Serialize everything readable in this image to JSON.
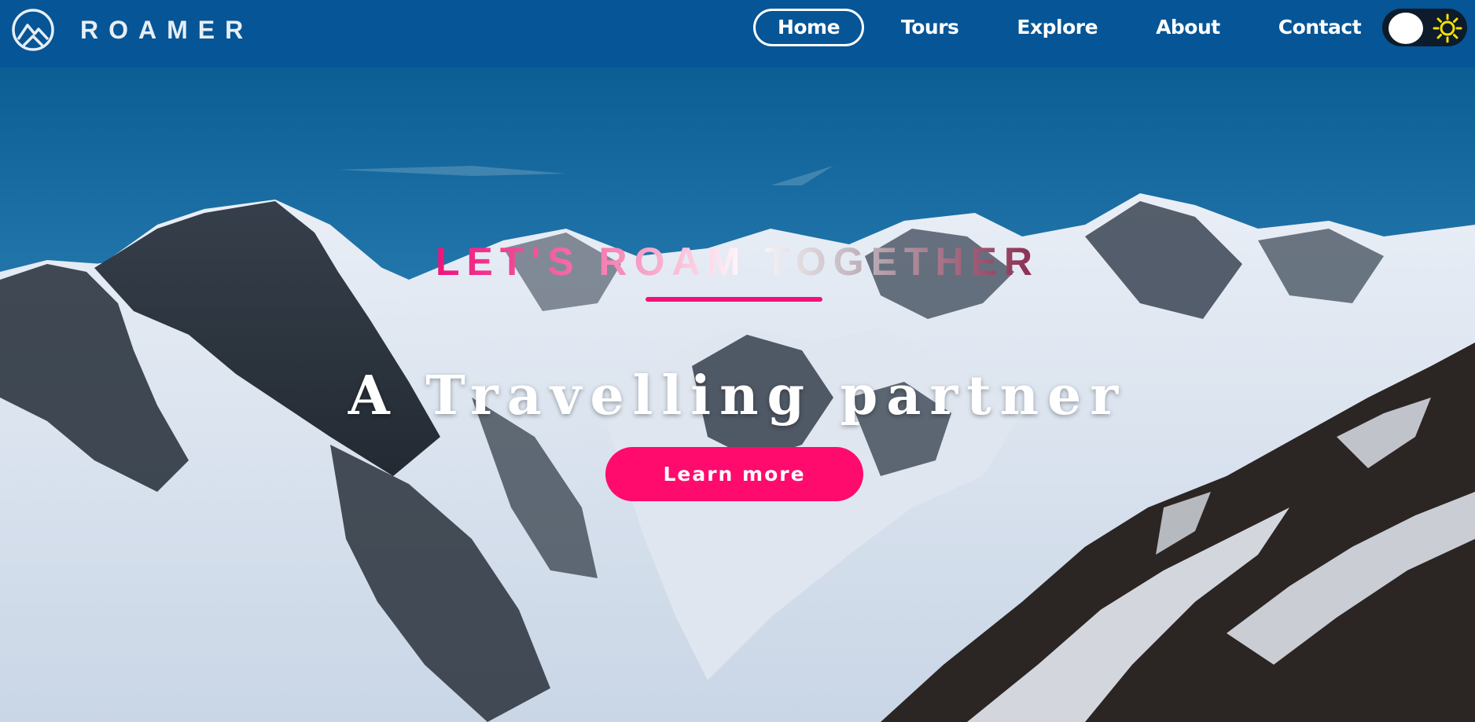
{
  "brand": {
    "name": "ROAMER",
    "logo_icon": "mountain-circle-logo-icon"
  },
  "nav": {
    "items": [
      {
        "label": "Home",
        "active": true
      },
      {
        "label": "Tours",
        "active": false
      },
      {
        "label": "Explore",
        "active": false
      },
      {
        "label": "About",
        "active": false
      },
      {
        "label": "Contact",
        "active": false
      }
    ]
  },
  "theme_toggle": {
    "icon": "sun-icon",
    "state": "light"
  },
  "hero": {
    "tagline": "LET'S ROAM TOGETHER",
    "headline": "A Travelling partner",
    "cta_label": "Learn more"
  },
  "colors": {
    "navbar": "#065596",
    "accent": "#ff0b6d",
    "sun": "#f5e100"
  }
}
